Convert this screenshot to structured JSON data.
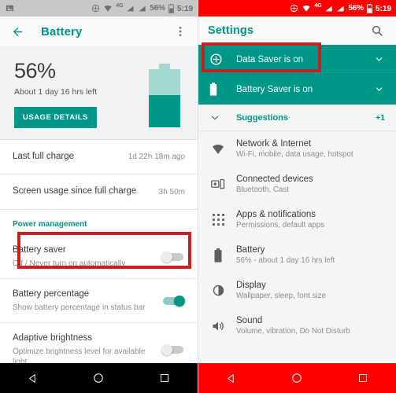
{
  "left": {
    "statusbar": {
      "icons": [
        "screenshot-icon",
        "location-icon",
        "wifi-icon",
        "signal-4g-icon",
        "signal-icon"
      ],
      "network_label": "4G",
      "battery_pct": "56%",
      "time": "5:19"
    },
    "appbar": {
      "back_icon": "back-arrow-icon",
      "title": "Battery",
      "overflow_icon": "more-vert-icon"
    },
    "hero": {
      "percent": "56%",
      "remaining": "About 1 day 16 hrs left",
      "usage_button": "USAGE DETAILS",
      "battery_fill_percent": 56
    },
    "info_rows": [
      {
        "title": "Last full charge",
        "value": "1d 22h 18m ago"
      },
      {
        "title": "Screen usage since full charge",
        "value": "3h 50m"
      }
    ],
    "section_label": "Power management",
    "settings_rows": [
      {
        "title": "Battery saver",
        "sub": "Off / Never turn on automatically",
        "toggle": "off"
      },
      {
        "title": "Battery percentage",
        "sub": "Show battery percentage in status bar",
        "toggle": "on"
      },
      {
        "title": "Adaptive brightness",
        "sub": "Optimize brightness level for available light",
        "toggle": "off"
      }
    ],
    "navbar": {
      "back": "nav-back-icon",
      "home": "nav-home-icon",
      "recents": "nav-recents-icon"
    }
  },
  "right": {
    "statusbar": {
      "network_label": "4G",
      "battery_pct": "56%",
      "time": "5:19"
    },
    "appbar": {
      "title": "Settings",
      "search_icon": "search-icon"
    },
    "banners": [
      {
        "icon": "data-saver-icon",
        "label": "Data Saver is on",
        "chevron": "chevron-down-icon"
      },
      {
        "icon": "battery-icon",
        "label": "Battery Saver is on",
        "chevron": "chevron-down-icon"
      }
    ],
    "suggestions": {
      "chevron": "chevron-down-icon",
      "label": "Suggestions",
      "count": "+1"
    },
    "settings_rows": [
      {
        "icon": "wifi-icon",
        "title": "Network & Internet",
        "sub": "Wi-Fi, mobile, data usage, hotspot"
      },
      {
        "icon": "connected-devices-icon",
        "title": "Connected devices",
        "sub": "Bluetooth, Cast"
      },
      {
        "icon": "apps-grid-icon",
        "title": "Apps & notifications",
        "sub": "Permissions, default apps"
      },
      {
        "icon": "battery-icon",
        "title": "Battery",
        "sub": "56% - about 1 day 16 hrs left"
      },
      {
        "icon": "display-brightness-icon",
        "title": "Display",
        "sub": "Wallpaper, sleep, font size"
      },
      {
        "icon": "sound-volume-icon",
        "title": "Sound",
        "sub": "Volume, vibration, Do Not Disturb"
      }
    ],
    "navbar": {
      "back": "nav-back-icon",
      "home": "nav-home-icon",
      "recents": "nav-recents-icon"
    }
  },
  "colors": {
    "accent_teal": "#009688",
    "banner_teal": "#009688",
    "highlight_red": "#c62020",
    "status_red": "#ff0000",
    "battery_light": "#a6d8d2"
  }
}
